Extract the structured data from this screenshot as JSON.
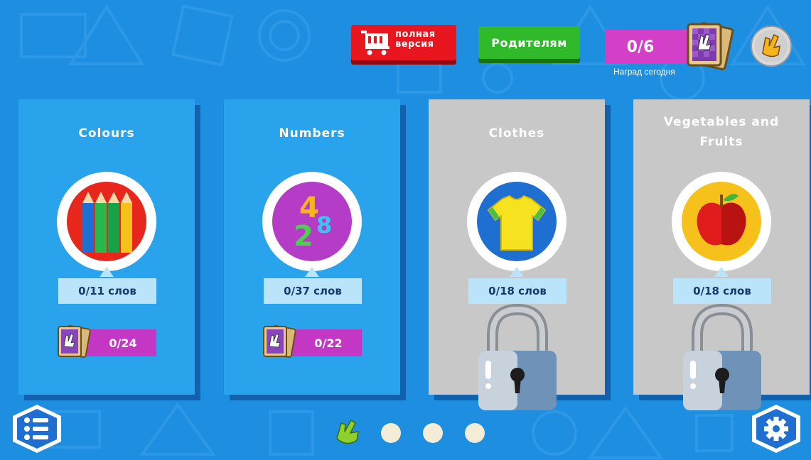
{
  "header": {
    "full_version_line1": "полная",
    "full_version_line2": "версия",
    "parents_label": "Родителям",
    "rewards_value": "0/6",
    "rewards_caption": "Наград сегодня",
    "cart_icon": "shopping-cart-icon",
    "reward_cards_icon": "reward-cards-icon",
    "profile_icon": "hand-peace-icon"
  },
  "categories": [
    {
      "title": "Colours",
      "words": "0/11 слов",
      "cards": "0/24",
      "locked": false,
      "icon": "pencils-icon"
    },
    {
      "title": "Numbers",
      "words": "0/37 слов",
      "cards": "0/22",
      "locked": false,
      "icon": "numbers-icon"
    },
    {
      "title": "Clothes",
      "words": "0/18 слов",
      "locked": true,
      "icon": "tshirt-icon"
    },
    {
      "title": "Vegetables and Fruits",
      "words": "0/18 слов",
      "locked": true,
      "icon": "apple-icon"
    }
  ],
  "footer": {
    "menu_icon": "list-menu-icon",
    "settings_icon": "gear-icon",
    "pager_pages": 4,
    "pager_current": 1
  },
  "colors": {
    "background": "#1e8fe0",
    "card_active": "#29a3ec",
    "card_locked": "#c8c8c8",
    "full_version": "#e8171f",
    "parents": "#2fb92b",
    "rewards": "#d43fc7"
  }
}
